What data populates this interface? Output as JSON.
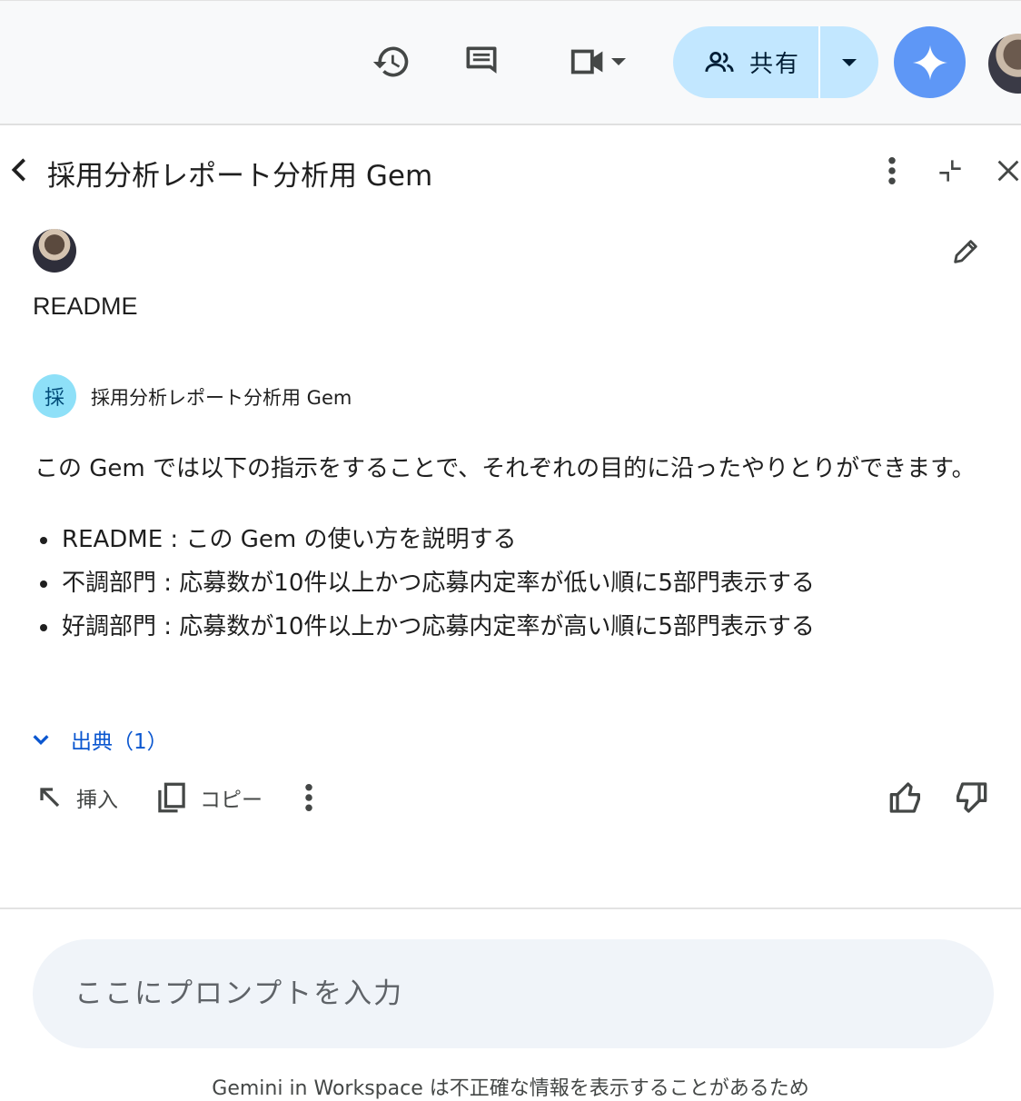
{
  "toolbar": {
    "share_label": "共有"
  },
  "panel": {
    "title": "採用分析レポート分析用 Gem"
  },
  "conversation": {
    "user_prompt": "README",
    "gem_initial": "採",
    "gem_name": "採用分析レポート分析用 Gem",
    "response_paragraph": "この Gem では以下の指示をすることで、それぞれの目的に沿ったやりとりができます。",
    "response_items": [
      "README : この Gem の使い方を説明する",
      "不調部門 : 応募数が10件以上かつ応募内定率が低い順に5部門表示する",
      "好調部門 : 応募数が10件以上かつ応募内定率が高い順に5部門表示する"
    ],
    "sources_label": "出典（1）"
  },
  "actions": {
    "insert_label": "挿入",
    "copy_label": "コピー"
  },
  "input": {
    "placeholder": "ここにプロンプトを入力"
  },
  "footer": {
    "disclaimer": "Gemini in Workspace は不正確な情報を表示することがあるため"
  },
  "colors": {
    "share_bg": "#c2e7ff",
    "gemini_button": "#5e97f6",
    "link_blue": "#0b57d0",
    "prompt_bg": "#f0f4f9"
  }
}
